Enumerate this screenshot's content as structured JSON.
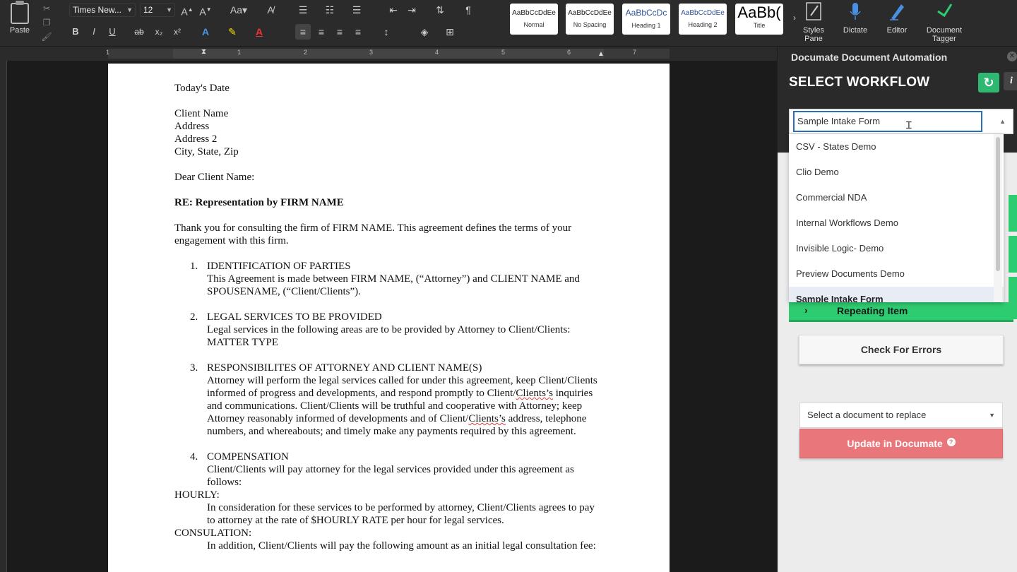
{
  "ribbon": {
    "paste_label": "Paste",
    "font_name": "Times New...",
    "font_size": "12",
    "styles": [
      {
        "sample": "AaBbCcDdEe",
        "name": "Normal"
      },
      {
        "sample": "AaBbCcDdEe",
        "name": "No Spacing"
      },
      {
        "sample": "AaBbCcDc",
        "name": "Heading 1"
      },
      {
        "sample": "AaBbCcDdEe",
        "name": "Heading 2"
      },
      {
        "sample": "AaBb(",
        "name": "Title"
      }
    ],
    "tools": [
      {
        "label1": "Styles",
        "label2": "Pane"
      },
      {
        "label1": "Dictate",
        "label2": ""
      },
      {
        "label1": "Editor",
        "label2": ""
      },
      {
        "label1": "Document",
        "label2": "Tagger"
      }
    ],
    "ruler_numbers": [
      "1",
      "1",
      "2",
      "3",
      "4",
      "5",
      "6",
      "7"
    ]
  },
  "document": {
    "date": "Today's Date",
    "address": [
      "Client Name",
      "Address",
      "Address 2",
      "City, State, Zip"
    ],
    "salutation": "Dear Client Name:",
    "re_line": "RE: Representation by FIRM NAME",
    "intro": "Thank you for consulting the firm of FIRM NAME. This agreement defines the terms of your engagement with this firm.",
    "sections": [
      {
        "num": "1.",
        "title": "IDENTIFICATION OF PARTIES",
        "body": "This Agreement is made between FIRM NAME, (“Attorney”) and CLIENT NAME and SPOUSENAME, (“Client/Clients”)."
      },
      {
        "num": "2.",
        "title": "LEGAL SERVICES TO BE PROVIDED",
        "body": "Legal services in the following areas are to be provided by Attorney to Client/Clients: MATTER TYPE"
      },
      {
        "num": "3.",
        "title": "RESPONSIBILITES OF ATTORNEY AND CLIENT NAME(S)",
        "body_a": "Attorney will perform the legal services called for under this agreement, keep Client/Clients informed of progress and developments, and respond promptly to Client/",
        "squig_a": "Clients’s",
        "body_b": " inquiries and communications. Client/Clients will be truthful and cooperative with Attorney; keep Attorney reasonably informed of developments and of Client/",
        "squig_b": "Clients’s",
        "body_c": " address, telephone numbers, and whereabouts; and timely make any payments required by this agreement."
      },
      {
        "num": "4.",
        "title": "COMPENSATION",
        "body": "Client/Clients will pay attorney for the legal services provided under this agreement as follows:"
      }
    ],
    "hourly_label": "HOURLY:",
    "hourly_body": "In consideration for these services to be performed by attorney, Client/Clients agrees to pay to attorney at the rate of $HOURLY RATE per hour for legal services.",
    "consult_label": "CONSULATION:",
    "consult_body": "In addition, Client/Clients will pay the following amount as an initial legal consultation fee:"
  },
  "pane": {
    "title": "Documate Document Automation",
    "close_icon": "close-icon",
    "heading": "SELECT WORKFLOW",
    "refresh_glyph": "↻",
    "info_glyph": "i",
    "workflow_value": "Sample Intake Form",
    "workflows": [
      "CSV - States Demo",
      "Clio Demo",
      "Commercial NDA",
      "Internal Workflows Demo",
      "Invisible Logic- Demo",
      "Preview Documents Demo",
      "Sample Intake Form"
    ],
    "selected_index": 6,
    "repeating_label": "Repeating Item",
    "check_label": "Check For Errors",
    "doc_select_placeholder": "Select a document to replace",
    "update_label": "Update in Documate",
    "accent_green": "#2ecc71",
    "update_color": "#e8767a"
  }
}
